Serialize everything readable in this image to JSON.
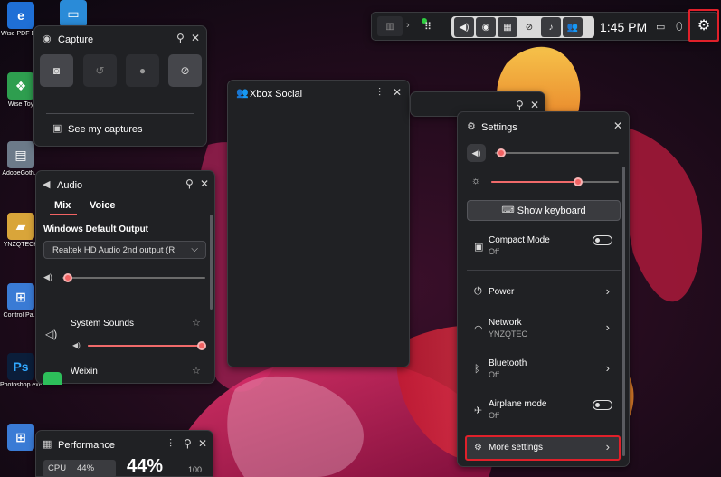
{
  "desktop": {
    "icons": [
      {
        "label": "Wise PDF E...",
        "glyph": "e"
      },
      {
        "label": "",
        "glyph": "▭"
      },
      {
        "label": "Wise Toy",
        "glyph": "❖"
      },
      {
        "label": "AdobeGoth...",
        "glyph": "▤"
      },
      {
        "label": "YNZQTECH",
        "glyph": "▰"
      },
      {
        "label": "Control Pa...",
        "glyph": "⊞"
      },
      {
        "label": "Photoshop.exe",
        "glyph": "Ps"
      },
      {
        "label": "",
        "glyph": "⊞"
      }
    ]
  },
  "gamebar": {
    "time": "1:45 PM",
    "widget_icons": [
      "chart-icon",
      "volume-icon",
      "camera-icon",
      "monitor-icon",
      "xbox-icon",
      "spotify-icon",
      "social-icon"
    ]
  },
  "capture": {
    "title": "Capture",
    "see_captures": "See my captures"
  },
  "audio": {
    "title": "Audio",
    "tabs": [
      "Mix",
      "Voice"
    ],
    "output_heading": "Windows Default Output",
    "output_device": "Realtek HD Audio 2nd output (R",
    "master_volume": 0.04,
    "apps": [
      {
        "name": "System Sounds",
        "volume": 1.0
      },
      {
        "name": "Weixin"
      }
    ]
  },
  "xbox_social": {
    "title": "Xbox Social"
  },
  "settings": {
    "title": "Settings",
    "volume_level": 0.05,
    "brightness_level": 0.68,
    "show_keyboard": "Show keyboard",
    "items": [
      {
        "label": "Compact Mode",
        "sub": "Off",
        "icon": "compact-mode-icon",
        "control": "toggle"
      },
      {
        "label": "Power",
        "sub": "",
        "icon": "power-icon",
        "control": "chevron"
      },
      {
        "label": "Network",
        "sub": "YNZQTEC",
        "icon": "wifi-icon",
        "control": "chevron"
      },
      {
        "label": "Bluetooth",
        "sub": "Off",
        "icon": "bluetooth-icon",
        "control": "chevron"
      },
      {
        "label": "Airplane mode",
        "sub": "Off",
        "icon": "airplane-icon",
        "control": "toggle"
      },
      {
        "label": "More settings",
        "sub": "",
        "icon": "gear-icon",
        "control": "chevron"
      }
    ]
  },
  "performance": {
    "title": "Performance",
    "cpu_label": "CPU",
    "cpu_small": "44%",
    "cpu_big": "44%",
    "max": "100"
  },
  "colors": {
    "accent": "#f26363",
    "highlight_box": "#e0202a",
    "panel_bg": "#202124"
  }
}
